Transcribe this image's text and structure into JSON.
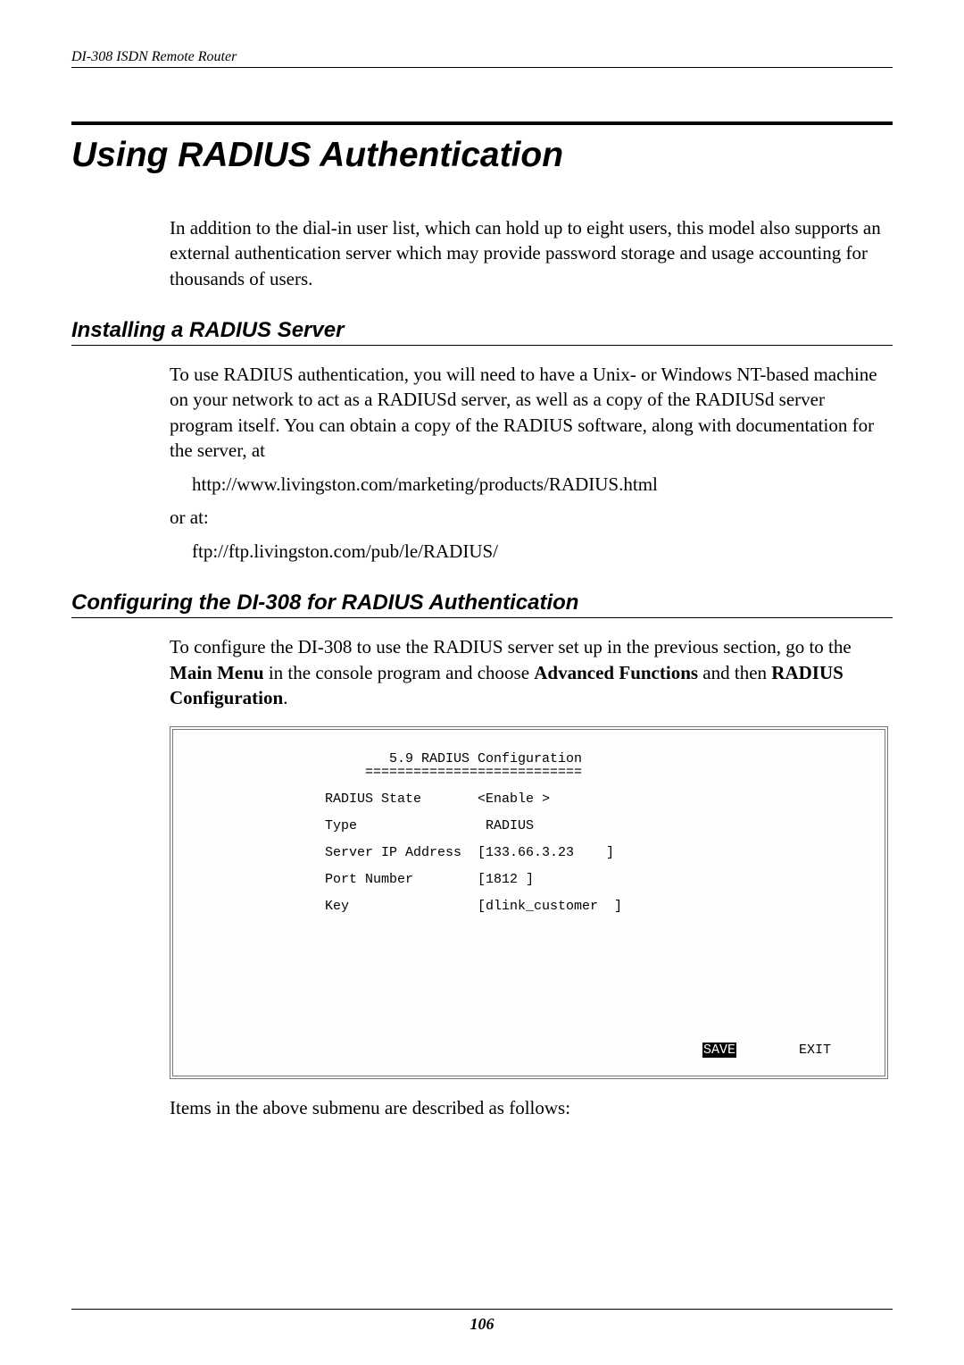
{
  "header": "DI-308 ISDN Remote Router",
  "chapter_title": "Using RADIUS Authentication",
  "intro_p1": "In addition to the dial-in user list, which can hold up to eight users, this model also supports an external authentication server which may provide password storage and usage accounting for thousands of users.",
  "section1": {
    "heading": "Installing a RADIUS Server",
    "p1": "To use RADIUS authentication, you will need to have a Unix- or Windows NT-based machine on your network to act as a RADIUSd server, as well as a copy of the RADIUSd server program itself. You can obtain a copy of the RADIUS software, along with documentation for the server, at",
    "url1": "http://www.livingston.com/marketing/products/RADIUS.html",
    "or": "or at:",
    "url2": "ftp://ftp.livingston.com/pub/le/RADIUS/"
  },
  "section2": {
    "heading": "Configuring the DI-308 for RADIUS Authentication",
    "p1_a": "To configure the DI-308 to use the RADIUS server set up in the previous section, go to the ",
    "p1_b": "Main Menu",
    "p1_c": " in the console program and choose ",
    "p1_d": "Advanced Functions",
    "p1_e": " and then ",
    "p1_f": "RADIUS Configuration",
    "p1_g": "."
  },
  "console": {
    "title": "        5.9 RADIUS Configuration",
    "divider": "     ===========================",
    "rows": {
      "state": "RADIUS State       <Enable >",
      "type": "Type                RADIUS",
      "ip": "Server IP Address  [133.66.3.23    ]",
      "port": "Port Number        [1812 ]",
      "key": "Key                [dlink_customer  ]"
    },
    "save": "SAVE",
    "exit": "EXIT"
  },
  "after_console": "Items in the above submenu are described as follows:",
  "page_number": "106"
}
